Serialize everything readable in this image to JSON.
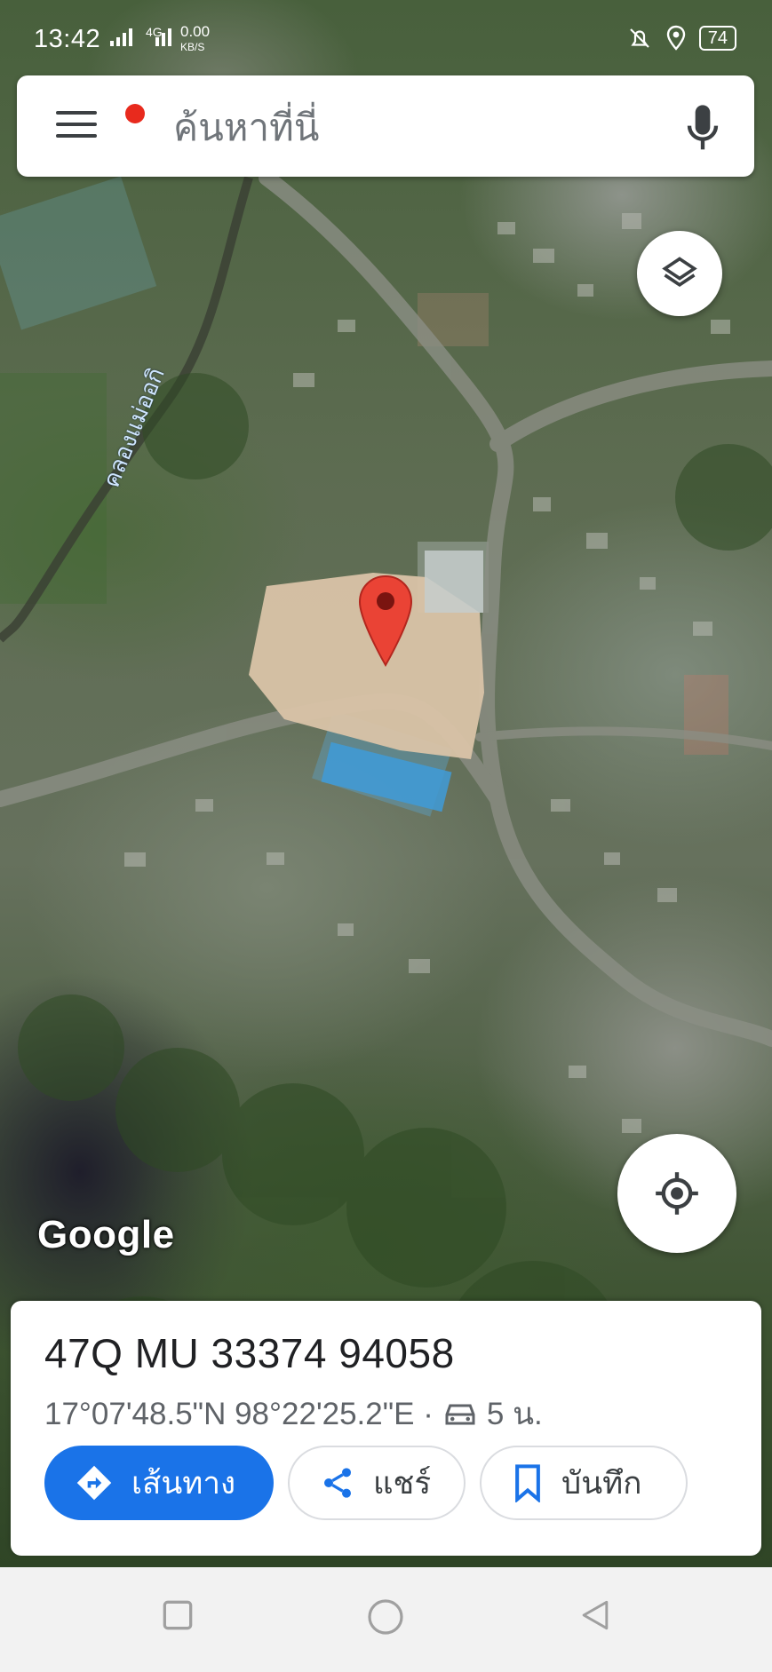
{
  "status_bar": {
    "time": "13:42",
    "network": "4G",
    "data_speed_value": "0.00",
    "data_speed_unit": "KB/S",
    "battery": "74"
  },
  "search": {
    "placeholder": "ค้นหาที่นี่"
  },
  "map": {
    "label_waterway": "คลองแม่ออกิ",
    "attribution": "Google"
  },
  "place": {
    "plus_code": "47Q  MU 33374 94058",
    "coordinates": "17°07'48.5\"N 98°22'25.2\"E ·",
    "drive_time": "5 น."
  },
  "actions": {
    "directions": "เส้นทาง",
    "share": "แชร์",
    "save": "บันทึก"
  },
  "colors": {
    "accent": "#1a73e8",
    "pin": "#ea4335",
    "notification_dot": "#e82a1d"
  }
}
